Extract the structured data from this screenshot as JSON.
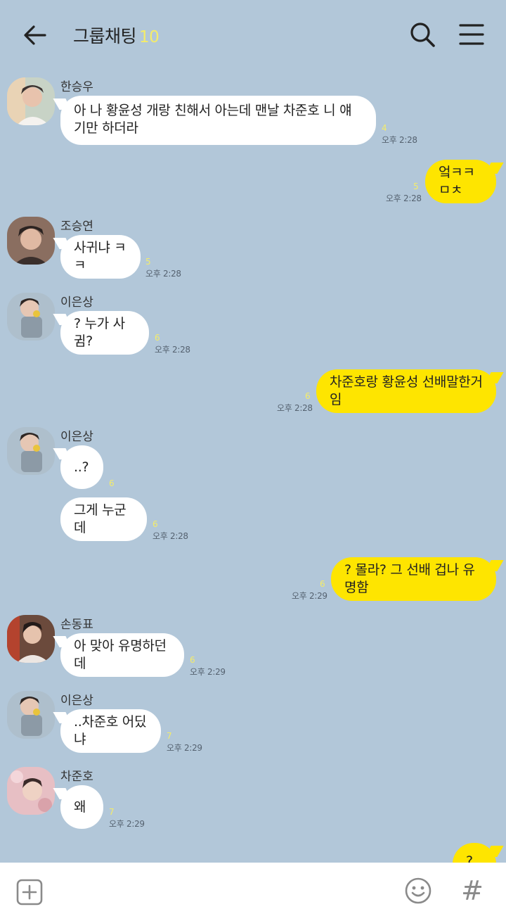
{
  "header": {
    "title": "그룹채팅",
    "member_count": "10"
  },
  "messages": [
    {
      "sender": "한승우",
      "text": "아 나 황윤성 개랑 친해서 아는데 맨날 차준호 니 얘기만 하더라",
      "unread": "4",
      "time": "오후 2:28"
    },
    {
      "sender": "me",
      "text": "엌ㅋㅋㅁㅊ",
      "unread": "5",
      "time": "오후 2:28"
    },
    {
      "sender": "조승연",
      "text": "사귀냐 ㅋㅋ",
      "unread": "5",
      "time": "오후 2:28"
    },
    {
      "sender": "이은상",
      "text": "? 누가 사귐?",
      "unread": "6",
      "time": "오후 2:28"
    },
    {
      "sender": "me",
      "text": "차준호랑 황윤성 선배말한거임",
      "unread": "6",
      "time": "오후 2:28"
    },
    {
      "sender": "이은상",
      "text": "..?",
      "unread": "6",
      "time": ""
    },
    {
      "sender": "",
      "text": "그게 누군데",
      "unread": "6",
      "time": "오후 2:28"
    },
    {
      "sender": "me",
      "text": "? 몰라? 그 선배 겁나 유명함",
      "unread": "6",
      "time": "오후 2:29"
    },
    {
      "sender": "손동표",
      "text": "아 맞아 유명하던데",
      "unread": "6",
      "time": "오후 2:29"
    },
    {
      "sender": "이은상",
      "text": "..차준호 어딨냐",
      "unread": "7",
      "time": "오후 2:29"
    },
    {
      "sender": "차준호",
      "text": "왜",
      "unread": "7",
      "time": "오후 2:29"
    },
    {
      "sender": "me",
      "text": "?",
      "unread": "",
      "time": ""
    }
  ],
  "icons": {
    "back": "arrow-left-icon",
    "search": "search-icon",
    "menu": "menu-icon",
    "plus": "plus-square-icon",
    "emoji": "smiley-icon",
    "hash": "#"
  },
  "colors": {
    "background": "#b2c7d9",
    "my_bubble": "#fee500",
    "other_bubble": "#ffffff",
    "unread": "#f4ec6a"
  }
}
